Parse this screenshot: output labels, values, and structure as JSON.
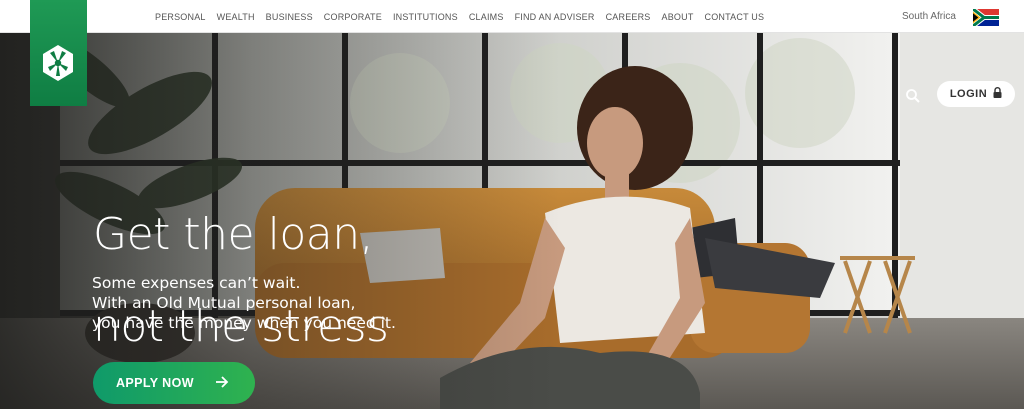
{
  "nav": {
    "items": [
      "PERSONAL",
      "WEALTH",
      "BUSINESS",
      "CORPORATE",
      "INSTITUTIONS",
      "CLAIMS",
      "FIND AN ADVISER",
      "CAREERS",
      "ABOUT",
      "CONTACT US"
    ],
    "region": "South Africa"
  },
  "header": {
    "login_label": "LOGIN"
  },
  "hero": {
    "headline_line1": "Get the loan,",
    "headline_line2": "not the stress",
    "sub_line1": "Some expenses can’t wait.",
    "sub_line2": "With an Old Mutual personal loan,",
    "sub_line3": "you have the money when you need it.",
    "cta_label": "APPLY NOW"
  },
  "carousel": {
    "slides": 4,
    "active": 4
  },
  "icons": {
    "logo": "old-mutual-logo-icon",
    "search": "search-icon",
    "lock": "lock-icon",
    "arrow": "arrow-right-icon",
    "flag": "south-africa-flag-icon"
  },
  "colors": {
    "brand_green": "#0f7d43",
    "cta_start": "#0f9a6a",
    "cta_end": "#2fb24f"
  }
}
